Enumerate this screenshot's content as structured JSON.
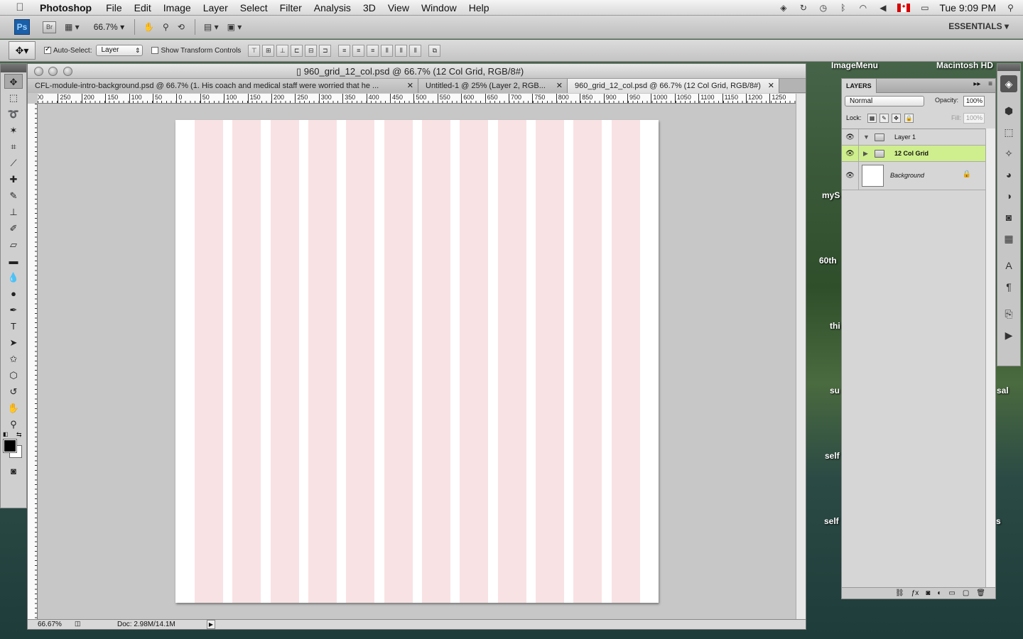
{
  "menubar": {
    "app_name": "Photoshop",
    "items": [
      "File",
      "Edit",
      "Image",
      "Layer",
      "Select",
      "Filter",
      "Analysis",
      "3D",
      "View",
      "Window",
      "Help"
    ],
    "clock": "Tue 9:09 PM"
  },
  "appbar": {
    "ps_logo": "Ps",
    "bridge_logo": "Br",
    "zoom": "66.7%",
    "workspace": "ESSENTIALS ▾"
  },
  "options": {
    "auto_select_label": "Auto-Select:",
    "auto_select_checked": true,
    "auto_select_value": "Layer",
    "show_transform_label": "Show Transform Controls"
  },
  "document": {
    "window_title": "960_grid_12_col.psd @ 66.7% (12 Col Grid, RGB/8#)",
    "tabs": [
      {
        "label": "CFL-module-intro-background.psd @ 66.7% (1.  His coach and medical staff were worried that he ...",
        "active": false
      },
      {
        "label": "Untitled-1 @ 25% (Layer 2, RGB...",
        "active": false
      },
      {
        "label": "960_grid_12_col.psd @ 66.7% (12 Col Grid, RGB/8#)",
        "active": true
      }
    ],
    "ruler_labels": [
      "00",
      "250",
      "200",
      "150",
      "100",
      "50",
      "0",
      "50",
      "100",
      "150",
      "200",
      "250",
      "300",
      "350",
      "400",
      "450",
      "500",
      "550",
      "600",
      "650",
      "700",
      "750",
      "800",
      "850",
      "900",
      "950",
      "1000",
      "1050",
      "1100",
      "1150",
      "1200",
      "1250"
    ],
    "grid": {
      "columns": 12,
      "column_color": "#f9e2e4",
      "canvas_color": "#ffffff"
    },
    "status_zoom": "66.67%",
    "status_doc": "Doc: 2.98M/14.1M"
  },
  "layers_panel": {
    "tab_label": "LAYERS",
    "blend_mode": "Normal",
    "opacity_label": "Opacity:",
    "opacity_value": "100%",
    "lock_label": "Lock:",
    "fill_label": "Fill:",
    "fill_value": "100%",
    "layers": [
      {
        "name": "Layer 1",
        "type": "group",
        "expanded": true,
        "selected": false
      },
      {
        "name": "12 Col Grid",
        "type": "group",
        "expanded": false,
        "selected": true
      },
      {
        "name": "Background",
        "type": "background",
        "locked": true
      }
    ]
  },
  "desktop": {
    "labels": [
      "ImageMenu",
      "Macintosh HD",
      "myS",
      "60th",
      "thi",
      "su",
      "sal",
      "self",
      "self",
      "s"
    ]
  }
}
